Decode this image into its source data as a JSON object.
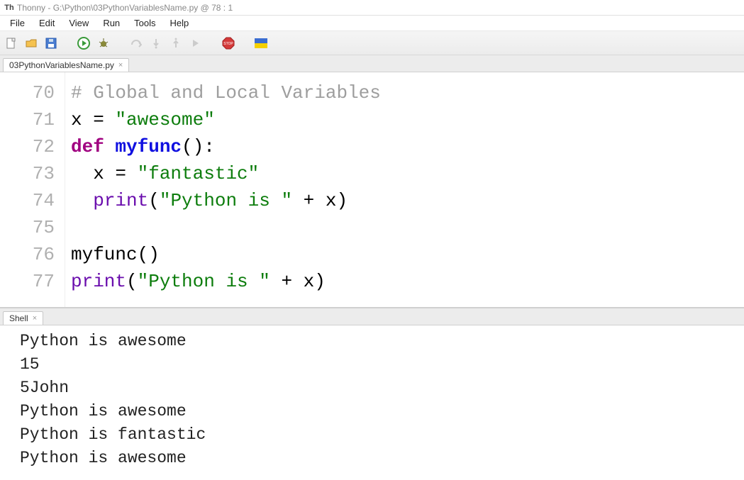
{
  "title": "Thonny  -  G:\\Python\\03PythonVariablesName.py  @  78 : 1",
  "menu": {
    "file": "File",
    "edit": "Edit",
    "view": "View",
    "run": "Run",
    "tools": "Tools",
    "help": "Help"
  },
  "tab": {
    "name": "03PythonVariablesName.py"
  },
  "shell_tab": {
    "name": "Shell"
  },
  "code_lines": [
    {
      "num": "70",
      "tokens": [
        {
          "t": "# Global and Local Variables",
          "c": "c-comment"
        }
      ]
    },
    {
      "num": "71",
      "tokens": [
        {
          "t": "x = ",
          "c": ""
        },
        {
          "t": "\"awesome\"",
          "c": "c-str"
        }
      ]
    },
    {
      "num": "72",
      "tokens": [
        {
          "t": "def ",
          "c": "c-kw"
        },
        {
          "t": "myfunc",
          "c": "c-def"
        },
        {
          "t": "():",
          "c": ""
        }
      ]
    },
    {
      "num": "73",
      "tokens": [
        {
          "t": "  x = ",
          "c": ""
        },
        {
          "t": "\"fantastic\"",
          "c": "c-str"
        }
      ]
    },
    {
      "num": "74",
      "tokens": [
        {
          "t": "  ",
          "c": ""
        },
        {
          "t": "print",
          "c": "c-call"
        },
        {
          "t": "(",
          "c": ""
        },
        {
          "t": "\"Python is \"",
          "c": "c-str"
        },
        {
          "t": " + x)",
          "c": ""
        }
      ]
    },
    {
      "num": "75",
      "tokens": [
        {
          "t": "",
          "c": ""
        }
      ]
    },
    {
      "num": "76",
      "tokens": [
        {
          "t": "myfunc()",
          "c": ""
        }
      ]
    },
    {
      "num": "77",
      "tokens": [
        {
          "t": "print",
          "c": "c-call"
        },
        {
          "t": "(",
          "c": ""
        },
        {
          "t": "\"Python is \"",
          "c": "c-str"
        },
        {
          "t": " + x)",
          "c": ""
        }
      ]
    }
  ],
  "shell_output": [
    "Python is awesome",
    "15",
    "5John",
    "Python is awesome",
    "Python is fantastic",
    "Python is awesome"
  ],
  "icons": {
    "new": "#fefefe",
    "open": "#d8a13c",
    "save": "#3a72c8",
    "run": "#39a339",
    "debug": "#6a6a2a",
    "stop": "#cc2b2b",
    "flag_top": "#3b6dd1",
    "flag_bot": "#f5d000"
  }
}
